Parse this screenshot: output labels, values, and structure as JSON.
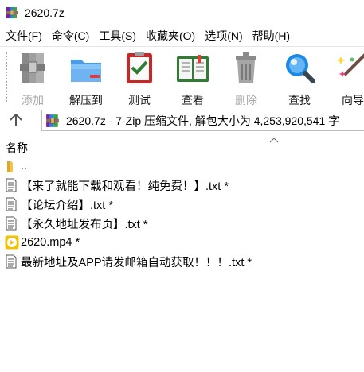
{
  "window": {
    "title": "2620.7z",
    "app_icon": "winrar-books-icon"
  },
  "menu": [
    "文件(F)",
    "命令(C)",
    "工具(S)",
    "收藏夹(O)",
    "选项(N)",
    "帮助(H)"
  ],
  "toolbar": {
    "add": {
      "label": "添加",
      "icon": "archive-add-icon",
      "enabled": false
    },
    "extract": {
      "label": "解压到",
      "icon": "folder-extract-icon",
      "enabled": true
    },
    "test": {
      "label": "测试",
      "icon": "test-checklist-icon",
      "enabled": true
    },
    "view": {
      "label": "查看",
      "icon": "open-book-icon",
      "enabled": true
    },
    "delete": {
      "label": "删除",
      "icon": "trash-can-icon",
      "enabled": false
    },
    "find": {
      "label": "查找",
      "icon": "magnifier-icon",
      "enabled": true
    },
    "wizard": {
      "label": "向导",
      "icon": "magic-wand-icon",
      "enabled": true
    }
  },
  "address": {
    "up_icon": "up-arrow-icon",
    "text": "2620.7z - 7-Zip 压缩文件, 解包大小为 4,253,920,541 字"
  },
  "columns": {
    "name": "名称",
    "sort": "ascending"
  },
  "files": [
    {
      "name": "..",
      "type": "folder",
      "icon": "folder-icon"
    },
    {
      "name": "【来了就能下载和观看！纯免费！】.txt *",
      "type": "text",
      "icon": "text-file-icon"
    },
    {
      "name": "【论坛介绍】.txt *",
      "type": "text",
      "icon": "text-file-icon"
    },
    {
      "name": "【永久地址发布页】.txt *",
      "type": "text",
      "icon": "text-file-icon"
    },
    {
      "name": "2620.mp4 *",
      "type": "video",
      "icon": "video-file-icon"
    },
    {
      "name": "最新地址及APP请发邮箱自动获取！！！.txt *",
      "type": "text",
      "icon": "text-file-icon"
    }
  ],
  "colors": {
    "background": "#ffffff",
    "disabled_text": "#a8a8a8",
    "video_icon": "#f2c200",
    "folder_icon": "#f3c24b"
  }
}
